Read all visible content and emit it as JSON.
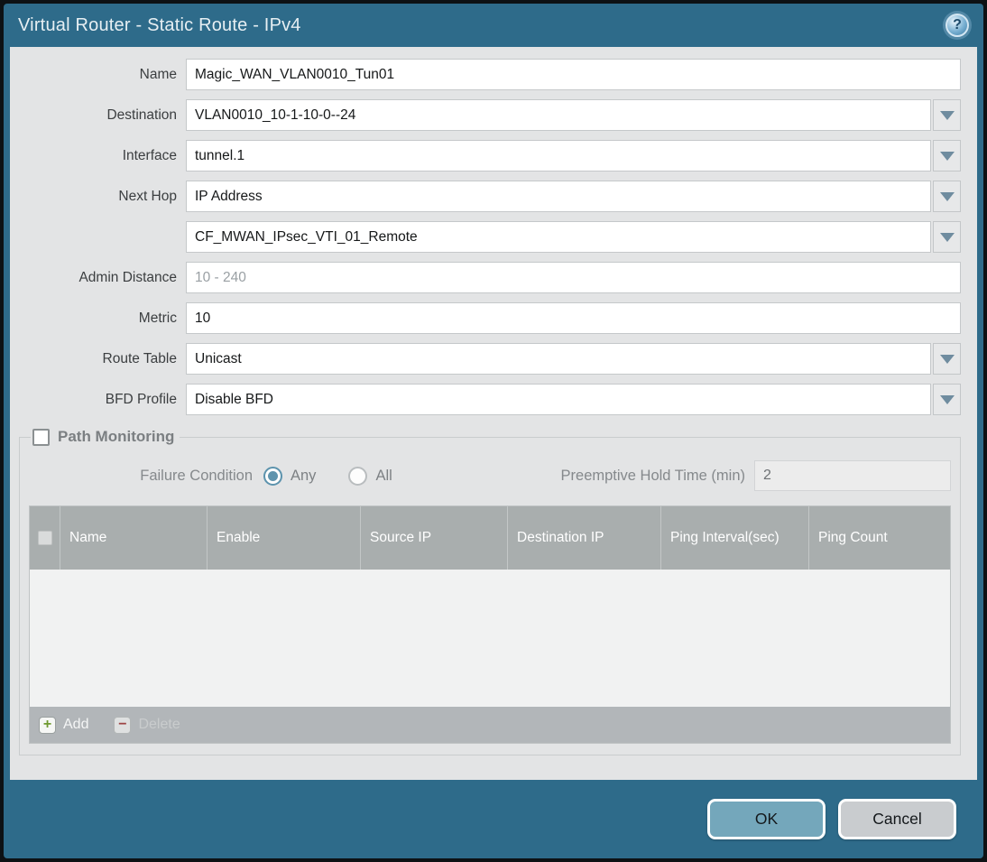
{
  "window": {
    "title": "Virtual Router - Static Route - IPv4",
    "help_icon": "?"
  },
  "colors": {
    "titlebar_teal": "#2e6b8a",
    "body_gray": "#e3e4e5",
    "table_header_gray": "#a9aeae",
    "ok_button": "#74a7bb",
    "cancel_button": "#c9cccf",
    "radio_selected": "#6094ad"
  },
  "form": {
    "name": {
      "label": "Name",
      "value": "Magic_WAN_VLAN0010_Tun01"
    },
    "destination": {
      "label": "Destination",
      "value": "VLAN0010_10-1-10-0--24"
    },
    "interface": {
      "label": "Interface",
      "value": "tunnel.1"
    },
    "next_hop": {
      "label": "Next Hop",
      "value": "IP Address"
    },
    "next_hop_address": {
      "value": "CF_MWAN_IPsec_VTI_01_Remote"
    },
    "admin_distance": {
      "label": "Admin Distance",
      "value": "",
      "placeholder": "10 - 240"
    },
    "metric": {
      "label": "Metric",
      "value": "10"
    },
    "route_table": {
      "label": "Route Table",
      "value": "Unicast"
    },
    "bfd_profile": {
      "label": "BFD Profile",
      "value": "Disable BFD"
    }
  },
  "path_monitoring": {
    "title": "Path Monitoring",
    "checked": false,
    "failure_condition": {
      "label": "Failure Condition",
      "options": [
        {
          "label": "Any",
          "selected": true
        },
        {
          "label": "All",
          "selected": false
        }
      ]
    },
    "preemptive_hold_time": {
      "label": "Preemptive Hold Time (min)",
      "value": "2"
    },
    "table": {
      "columns": [
        "Name",
        "Enable",
        "Source IP",
        "Destination IP",
        "Ping Interval(sec)",
        "Ping Count"
      ],
      "rows": []
    },
    "toolbar": {
      "add_label": "Add",
      "delete_label": "Delete",
      "delete_disabled": true
    }
  },
  "footer": {
    "ok_label": "OK",
    "cancel_label": "Cancel"
  }
}
